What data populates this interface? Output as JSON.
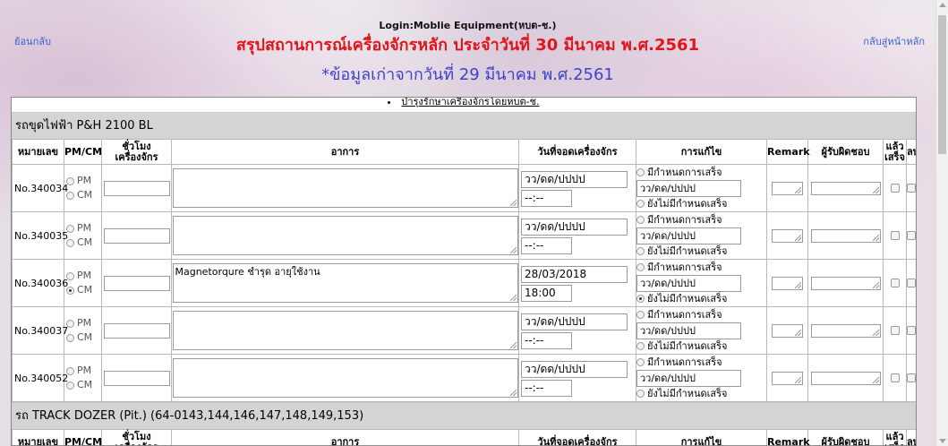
{
  "nav": {
    "back": "ย้อนกลับ",
    "home": "กลับสู่หน้าหลัก"
  },
  "header": {
    "login": "Login:Moblie Equipment(หบต-ช.)",
    "title": "สรุปสถานการณ์เครื่องจักรหลัก ประจำวันที่ 30 มีนาคม พ.ศ.2561",
    "subtitle": "*ข้อมูลเก่าจากวันที่ 29 มีนาคม พ.ศ.2561",
    "title_color": "#e0161c",
    "subtitle_color": "#4040cc"
  },
  "section_link": "บำรุงรักษาเครื่องจักรโดยหบต-ช.",
  "columns": [
    "หมายเลข",
    "PM/CM",
    "ชั่วโมง\nเครื่องจักร",
    "อาการ",
    "วันที่จอดเครื่องจักร",
    "การแก้ไข",
    "Remark",
    "ผู้รับผิดชอบ",
    "แล้ว\nเสร็จ",
    "ลบ"
  ],
  "pm_label": "PM",
  "cm_label": "CM",
  "fix_options": {
    "scheduled": "มีกำหนดการเสร็จ",
    "unscheduled": "ยังไม่มีกำหนดเสร็จ"
  },
  "date_placeholder": "วว/ดด/ปปปป",
  "time_placeholder": "--:--",
  "groups": [
    {
      "title": "รถขุดไฟฟ้า P&H 2100 BL",
      "rows": [
        {
          "number": "No.340034",
          "pmcm": "",
          "hours": "",
          "symptom": "",
          "stop_date": "วว/ดด/ปปปป",
          "stop_time": "--:--",
          "fix_date": "วว/ดด/ปปปป",
          "fix_choice": ""
        },
        {
          "number": "No.340035",
          "pmcm": "",
          "hours": "",
          "symptom": "",
          "stop_date": "วว/ดด/ปปปป",
          "stop_time": "--:--",
          "fix_date": "วว/ดด/ปปปป",
          "fix_choice": ""
        },
        {
          "number": "No.340036",
          "pmcm": "CM",
          "hours": "",
          "symptom": "Magnetorqure  ชำรุด อายุใช้งาน",
          "stop_date": "28/03/2018",
          "stop_time": "18:00",
          "fix_date": "วว/ดด/ปปปป",
          "fix_choice": "unscheduled"
        },
        {
          "number": "No.340037",
          "pmcm": "",
          "hours": "",
          "symptom": "",
          "stop_date": "วว/ดด/ปปปป",
          "stop_time": "--:--",
          "fix_date": "วว/ดด/ปปปป",
          "fix_choice": ""
        },
        {
          "number": "No.340052",
          "pmcm": "",
          "hours": "",
          "symptom": "",
          "stop_date": "วว/ดด/ปปปป",
          "stop_time": "--:--",
          "fix_date": "วว/ดด/ปปปป",
          "fix_choice": ""
        }
      ]
    },
    {
      "title": "รถ TRACK DOZER (Pit.) (64-0143,144,146,147,148,149,153)",
      "rows": []
    }
  ]
}
